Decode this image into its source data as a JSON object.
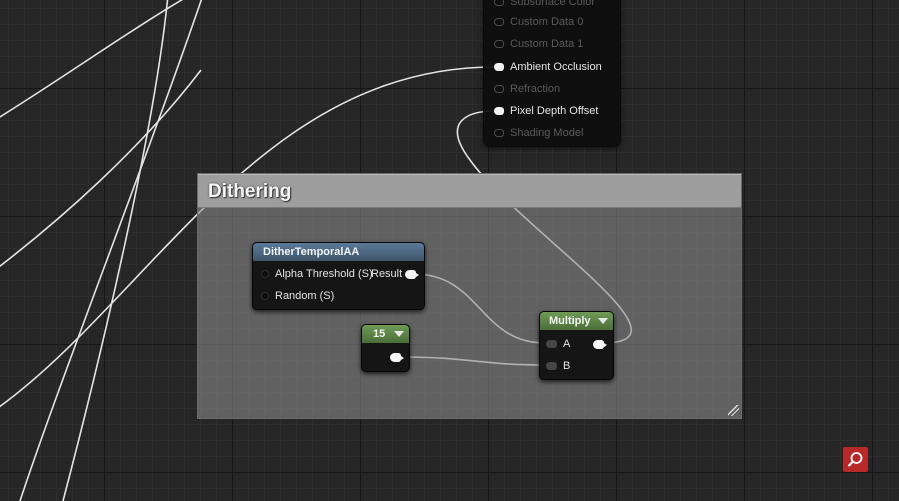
{
  "material_node": {
    "pins": [
      {
        "label": "Subsurface Color",
        "state": "dim"
      },
      {
        "label": "Custom Data 0",
        "state": "dim"
      },
      {
        "label": "Custom Data 1",
        "state": "dim"
      },
      {
        "label": "Ambient Occlusion",
        "state": "active"
      },
      {
        "label": "Refraction",
        "state": "dim"
      },
      {
        "label": "Pixel Depth Offset",
        "state": "active"
      },
      {
        "label": "Shading Model",
        "state": "dim"
      }
    ]
  },
  "comment": {
    "title": "Dithering"
  },
  "dither_node": {
    "title": "DitherTemporalAA",
    "input_alpha": "Alpha Threshold (S)",
    "output_result": "Result",
    "input_random": "Random (S)"
  },
  "constant_node": {
    "value": "15"
  },
  "multiply_node": {
    "title": "Multiply",
    "input_a": "A",
    "input_b": "B"
  },
  "icons": {
    "search": "search-icon",
    "dropdown": "chevron-down-icon",
    "resize": "resize-grip-icon"
  },
  "colors": {
    "background": "#262626",
    "texture_header": "#4e6880",
    "math_header": "#5e8747",
    "search_button": "#b8292a",
    "wire": "#e6e6e6"
  }
}
